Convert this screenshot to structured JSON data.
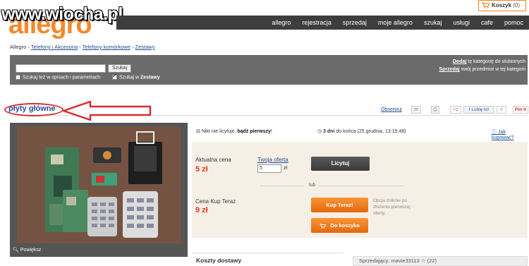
{
  "watermark": "www.wiocha.pl",
  "logo": "allegro",
  "cart": {
    "label": "Koszyk",
    "count": "(0)"
  },
  "nav": [
    "allegro",
    "rejestracja",
    "sprzedaj",
    "moje allegro",
    "szukaj",
    "usługi",
    "cafe",
    "pomoc"
  ],
  "breadcrumb": [
    "Allegro",
    "Telefony i Akcesoria",
    "Telefony komórkowe",
    "Zestawy"
  ],
  "favorites": {
    "line1_link": "Dodaj",
    "line1_text": " tę kategorię do ulubionych",
    "line2_link": "Sprzedaj",
    "line2_text": " swój przedmiot w tej kategorii"
  },
  "search": {
    "value": "",
    "button": "Szukaj",
    "option1": "Szukaj też w opisach i parametrach",
    "option2_prefix": "Szukaj w ",
    "option2_bold": "Zestawy"
  },
  "item": {
    "title": "płyty główne",
    "observe": "Obserwuj",
    "social": {
      "gplus": "+1",
      "like": "Lubię to!",
      "like_count": "0",
      "pin": "Pin it"
    },
    "zoom": "Powiększ",
    "bids_info": "Nikt nie licytuje, ",
    "bids_info_bold": "bądź pierwszy",
    "bids_info_end": "!",
    "time_bold": "3 dni",
    "time_rest": " do końca (25 grudnia, 13:15:48)",
    "help": "Jak kupować?",
    "current_price_label": "Aktualna cena",
    "current_price": "5 zł",
    "offer_label": "Twoja oferta",
    "offer_value": "5",
    "offer_unit": "zł",
    "bid_button": "Licytuj",
    "or": "lub",
    "buynow_label": "Cena Kup Teraz",
    "buynow_price": "9 zł",
    "buynow_button": "Kup Teraz!",
    "cart_button": "Do koszyka",
    "buynow_note": "Opcja zniknie po złożeniu pierwszej oferty.",
    "shipping": "Koszty dostawy",
    "seller": "Sprzedający: mavie33113 ☆ (22)"
  },
  "colors": {
    "accent": "#f58220",
    "nav_bg": "#3d3d3d",
    "price": "#e8381c",
    "annotation": "#d43030"
  }
}
